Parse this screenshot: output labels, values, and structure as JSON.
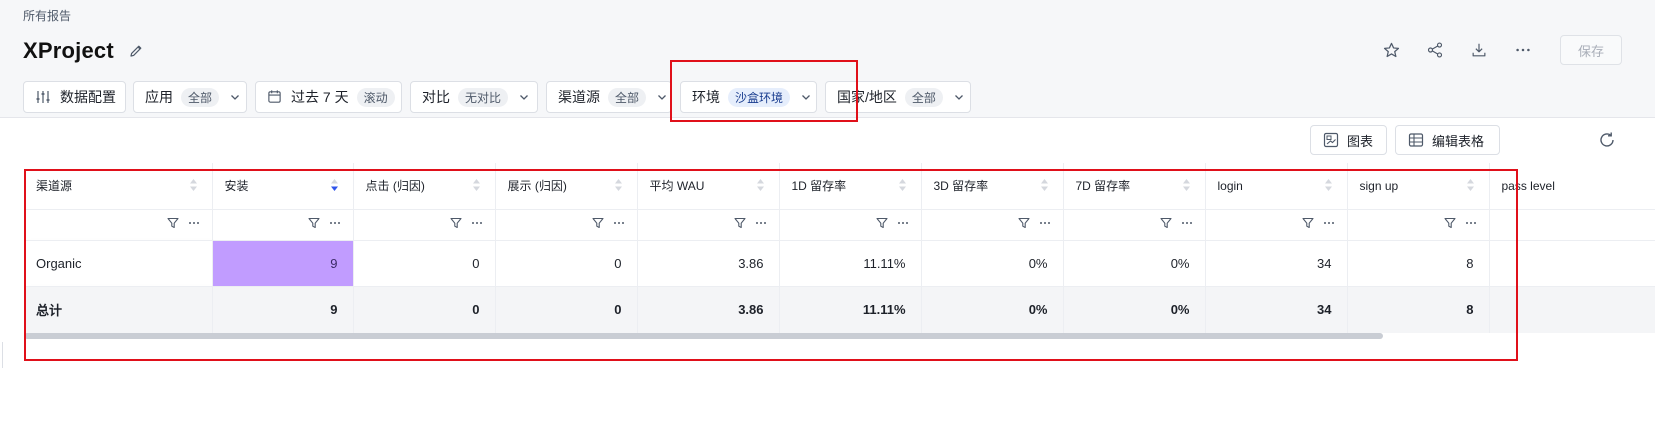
{
  "breadcrumb": "所有报告",
  "page": {
    "title": "XProject"
  },
  "top_actions": {
    "save_label": "保存"
  },
  "filters": [
    {
      "label": "数据配置",
      "tag": ""
    },
    {
      "label": "应用",
      "tag": "全部"
    },
    {
      "label": "过去 7 天",
      "tag": "滚动"
    },
    {
      "label": "对比",
      "tag": "无对比"
    },
    {
      "label": "渠道源",
      "tag": "全部"
    },
    {
      "label": "环境",
      "tag": "沙盒环境"
    },
    {
      "label": "国家/地区",
      "tag": "全部"
    }
  ],
  "view_buttons": {
    "chart": "图表",
    "edit_table": "编辑表格"
  },
  "table": {
    "columns": [
      "渠道源",
      "安装",
      "点击 (归因)",
      "展示 (归因)",
      "平均 WAU",
      "1D 留存率",
      "3D 留存率",
      "7D 留存率",
      "login",
      "sign up",
      "pass level"
    ],
    "rows": [
      [
        "Organic",
        "9",
        "0",
        "0",
        "3.86",
        "11.11%",
        "0%",
        "0%",
        "34",
        "8",
        ""
      ]
    ],
    "total": [
      "总计",
      "9",
      "0",
      "0",
      "3.86",
      "11.11%",
      "0%",
      "0%",
      "34",
      "8",
      ""
    ]
  },
  "colors": {
    "accent": "#2f54eb",
    "highlight_cell": "#c19cff",
    "annotation": "#e0101a"
  }
}
